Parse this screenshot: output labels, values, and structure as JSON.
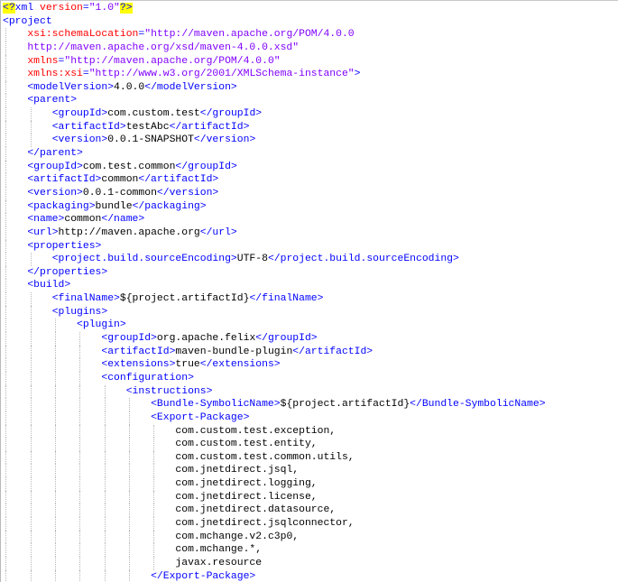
{
  "editor": {
    "lines": [
      {
        "indent": 0,
        "tokens": [
          [
            "decl",
            "<?"
          ],
          [
            "tag",
            "xml "
          ],
          [
            "attr",
            "version"
          ],
          [
            "eq",
            "="
          ],
          [
            "value",
            "\"1.0\""
          ],
          [
            "decl",
            "?>"
          ]
        ]
      },
      {
        "indent": 0,
        "tokens": [
          [
            "tag",
            "<project"
          ]
        ]
      },
      {
        "indent": 1,
        "tokens": [
          [
            "attr",
            "xsi:schemaLocation"
          ],
          [
            "eq",
            "="
          ],
          [
            "value",
            "\"http://maven.apache.org/POM/4.0.0"
          ]
        ]
      },
      {
        "indent": 1,
        "tokens": [
          [
            "value",
            "http://maven.apache.org/xsd/maven-4.0.0.xsd\""
          ]
        ]
      },
      {
        "indent": 1,
        "tokens": [
          [
            "attr",
            "xmlns"
          ],
          [
            "eq",
            "="
          ],
          [
            "value",
            "\"http://maven.apache.org/POM/4.0.0\""
          ]
        ]
      },
      {
        "indent": 1,
        "tokens": [
          [
            "attr",
            "xmlns:xsi"
          ],
          [
            "eq",
            "="
          ],
          [
            "value",
            "\"http://www.w3.org/2001/XMLSchema-instance\""
          ],
          [
            "tag",
            ">"
          ]
        ]
      },
      {
        "indent": 1,
        "tokens": [
          [
            "tag",
            "<modelVersion>"
          ],
          [
            "text",
            "4.0.0"
          ],
          [
            "tag",
            "</modelVersion>"
          ]
        ]
      },
      {
        "indent": 1,
        "tokens": [
          [
            "tag",
            "<parent>"
          ]
        ]
      },
      {
        "indent": 2,
        "tokens": [
          [
            "tag",
            "<groupId>"
          ],
          [
            "text",
            "com.custom.test"
          ],
          [
            "tag",
            "</groupId>"
          ]
        ]
      },
      {
        "indent": 2,
        "tokens": [
          [
            "tag",
            "<artifactId>"
          ],
          [
            "text",
            "testAbc"
          ],
          [
            "tag",
            "</artifactId>"
          ]
        ]
      },
      {
        "indent": 2,
        "tokens": [
          [
            "tag",
            "<version>"
          ],
          [
            "text",
            "0.0.1-SNAPSHOT"
          ],
          [
            "tag",
            "</version>"
          ]
        ]
      },
      {
        "indent": 1,
        "tokens": [
          [
            "tag",
            "</parent>"
          ]
        ]
      },
      {
        "indent": 1,
        "tokens": [
          [
            "tag",
            "<groupId>"
          ],
          [
            "text",
            "com.test.common"
          ],
          [
            "tag",
            "</groupId>"
          ]
        ]
      },
      {
        "indent": 1,
        "tokens": [
          [
            "tag",
            "<artifactId>"
          ],
          [
            "text",
            "common"
          ],
          [
            "tag",
            "</artifactId>"
          ]
        ]
      },
      {
        "indent": 1,
        "tokens": [
          [
            "tag",
            "<version>"
          ],
          [
            "text",
            "0.0.1-common"
          ],
          [
            "tag",
            "</version>"
          ]
        ]
      },
      {
        "indent": 1,
        "tokens": [
          [
            "tag",
            "<packaging>"
          ],
          [
            "text",
            "bundle"
          ],
          [
            "tag",
            "</packaging>"
          ]
        ]
      },
      {
        "indent": 1,
        "tokens": [
          [
            "tag",
            "<name>"
          ],
          [
            "text",
            "common"
          ],
          [
            "tag",
            "</name>"
          ]
        ]
      },
      {
        "indent": 1,
        "tokens": [
          [
            "tag",
            "<url>"
          ],
          [
            "text",
            "http://maven.apache.org"
          ],
          [
            "tag",
            "</url>"
          ]
        ]
      },
      {
        "indent": 1,
        "tokens": [
          [
            "tag",
            "<properties>"
          ]
        ]
      },
      {
        "indent": 2,
        "tokens": [
          [
            "tag",
            "<project.build.sourceEncoding>"
          ],
          [
            "text",
            "UTF-8"
          ],
          [
            "tag",
            "</project.build.sourceEncoding>"
          ]
        ]
      },
      {
        "indent": 1,
        "tokens": [
          [
            "tag",
            "</properties>"
          ]
        ]
      },
      {
        "indent": 1,
        "tokens": [
          [
            "tag",
            "<build>"
          ]
        ]
      },
      {
        "indent": 2,
        "tokens": [
          [
            "tag",
            "<finalName>"
          ],
          [
            "text",
            "${project.artifactId}"
          ],
          [
            "tag",
            "</finalName>"
          ]
        ]
      },
      {
        "indent": 2,
        "tokens": [
          [
            "tag",
            "<plugins>"
          ]
        ]
      },
      {
        "indent": 3,
        "tokens": [
          [
            "tag",
            "<plugin>"
          ]
        ]
      },
      {
        "indent": 4,
        "tokens": [
          [
            "tag",
            "<groupId>"
          ],
          [
            "text",
            "org.apache.felix"
          ],
          [
            "tag",
            "</groupId>"
          ]
        ]
      },
      {
        "indent": 4,
        "tokens": [
          [
            "tag",
            "<artifactId>"
          ],
          [
            "text",
            "maven-bundle-plugin"
          ],
          [
            "tag",
            "</artifactId>"
          ]
        ]
      },
      {
        "indent": 4,
        "tokens": [
          [
            "tag",
            "<extensions>"
          ],
          [
            "text",
            "true"
          ],
          [
            "tag",
            "</extensions>"
          ]
        ]
      },
      {
        "indent": 4,
        "tokens": [
          [
            "tag",
            "<configuration>"
          ]
        ]
      },
      {
        "indent": 5,
        "tokens": [
          [
            "tag",
            "<instructions>"
          ]
        ]
      },
      {
        "indent": 6,
        "tokens": [
          [
            "tag",
            "<Bundle-SymbolicName>"
          ],
          [
            "text",
            "${project.artifactId}"
          ],
          [
            "tag",
            "</Bundle-SymbolicName>"
          ]
        ]
      },
      {
        "indent": 6,
        "tokens": [
          [
            "tag",
            "<Export-Package>"
          ]
        ]
      },
      {
        "indent": 7,
        "tokens": [
          [
            "text",
            "com.custom.test.exception,"
          ]
        ]
      },
      {
        "indent": 7,
        "tokens": [
          [
            "text",
            "com.custom.test.entity,"
          ]
        ]
      },
      {
        "indent": 7,
        "tokens": [
          [
            "text",
            "com.custom.test.common.utils,"
          ]
        ]
      },
      {
        "indent": 7,
        "tokens": [
          [
            "text",
            "com.jnetdirect.jsql,"
          ]
        ]
      },
      {
        "indent": 7,
        "tokens": [
          [
            "text",
            "com.jnetdirect.logging,"
          ]
        ]
      },
      {
        "indent": 7,
        "tokens": [
          [
            "text",
            "com.jnetdirect.license,"
          ]
        ]
      },
      {
        "indent": 7,
        "tokens": [
          [
            "text",
            "com.jnetdirect.datasource,"
          ]
        ]
      },
      {
        "indent": 7,
        "tokens": [
          [
            "text",
            "com.jnetdirect.jsqlconnector,"
          ]
        ]
      },
      {
        "indent": 7,
        "tokens": [
          [
            "text",
            "com.mchange.v2.c3p0,"
          ]
        ]
      },
      {
        "indent": 7,
        "tokens": [
          [
            "text",
            "com.mchange.*,"
          ]
        ]
      },
      {
        "indent": 7,
        "tokens": [
          [
            "text",
            "javax.resource"
          ]
        ]
      },
      {
        "indent": 6,
        "tokens": [
          [
            "tag",
            "</Export-Package>"
          ]
        ]
      }
    ]
  },
  "colors": {
    "tag": "#0000ff",
    "attr": "#ff0000",
    "value": "#8000ff",
    "text": "#000000",
    "decl_highlight": "#ffff00"
  }
}
